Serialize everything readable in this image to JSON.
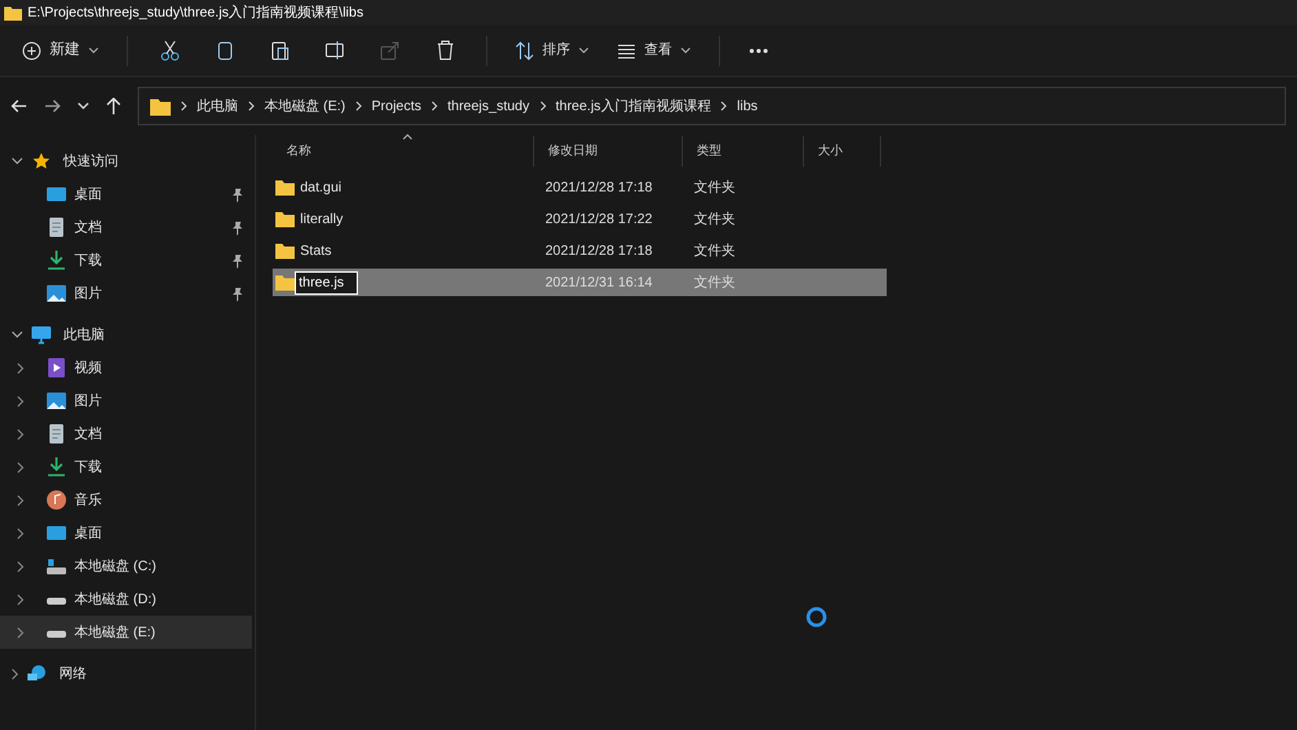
{
  "window": {
    "title": "E:\\Projects\\threejs_study\\three.js入门指南视频课程\\libs"
  },
  "toolbar": {
    "new_label": "新建",
    "sort_label": "排序",
    "view_label": "查看",
    "icons": [
      {
        "kind": "cut",
        "disabled": false
      },
      {
        "kind": "copy",
        "disabled": false
      },
      {
        "kind": "paste",
        "disabled": false
      },
      {
        "kind": "rename",
        "disabled": false
      },
      {
        "kind": "share",
        "disabled": true
      },
      {
        "kind": "delete",
        "disabled": false
      }
    ]
  },
  "breadcrumbs": [
    "此电脑",
    "本地磁盘 (E:)",
    "Projects",
    "threejs_study",
    "three.js入门指南视频课程",
    "libs"
  ],
  "sidebar": {
    "sections": [
      {
        "label": "快速访问",
        "kind": "star",
        "expanded": true,
        "children": [
          {
            "label": "桌面",
            "kind": "desktop",
            "pinned": true,
            "selected": false
          },
          {
            "label": "文档",
            "kind": "document",
            "pinned": true,
            "selected": false
          },
          {
            "label": "下载",
            "kind": "download",
            "pinned": true,
            "selected": false
          },
          {
            "label": "图片",
            "kind": "picture",
            "pinned": true,
            "selected": false
          }
        ]
      },
      {
        "label": "此电脑",
        "kind": "computer",
        "expanded": true,
        "children": [
          {
            "label": "视频",
            "kind": "video",
            "expanded": false,
            "selected": false
          },
          {
            "label": "图片",
            "kind": "picture",
            "expanded": false,
            "selected": false
          },
          {
            "label": "文档",
            "kind": "document",
            "expanded": false,
            "selected": false
          },
          {
            "label": "下载",
            "kind": "download",
            "expanded": false,
            "selected": false
          },
          {
            "label": "音乐",
            "kind": "music",
            "expanded": false,
            "selected": false
          },
          {
            "label": "桌面",
            "kind": "desktop",
            "expanded": false,
            "selected": false
          },
          {
            "label": "本地磁盘 (C:)",
            "kind": "system-drive",
            "expanded": false,
            "selected": false
          },
          {
            "label": "本地磁盘 (D:)",
            "kind": "drive",
            "expanded": false,
            "selected": false
          },
          {
            "label": "本地磁盘 (E:)",
            "kind": "drive",
            "expanded": false,
            "selected": true
          }
        ]
      },
      {
        "label": "网络",
        "kind": "network",
        "expanded": false
      }
    ]
  },
  "table": {
    "columns": [
      {
        "label": "名称",
        "sorted": true
      },
      {
        "label": "修改日期",
        "sorted": false
      },
      {
        "label": "类型",
        "sorted": false
      },
      {
        "label": "大小",
        "sorted": false
      }
    ],
    "rows": [
      {
        "name": "dat.gui",
        "modified": "2021/12/28 17:18",
        "type": "文件夹",
        "selected": false,
        "renaming": false
      },
      {
        "name": "literally",
        "modified": "2021/12/28 17:22",
        "type": "文件夹",
        "selected": false,
        "renaming": false
      },
      {
        "name": "Stats",
        "modified": "2021/12/28 17:18",
        "type": "文件夹",
        "selected": false,
        "renaming": false
      },
      {
        "name": "three.js",
        "modified": "2021/12/31 16:14",
        "type": "文件夹",
        "selected": true,
        "renaming": true
      }
    ]
  }
}
